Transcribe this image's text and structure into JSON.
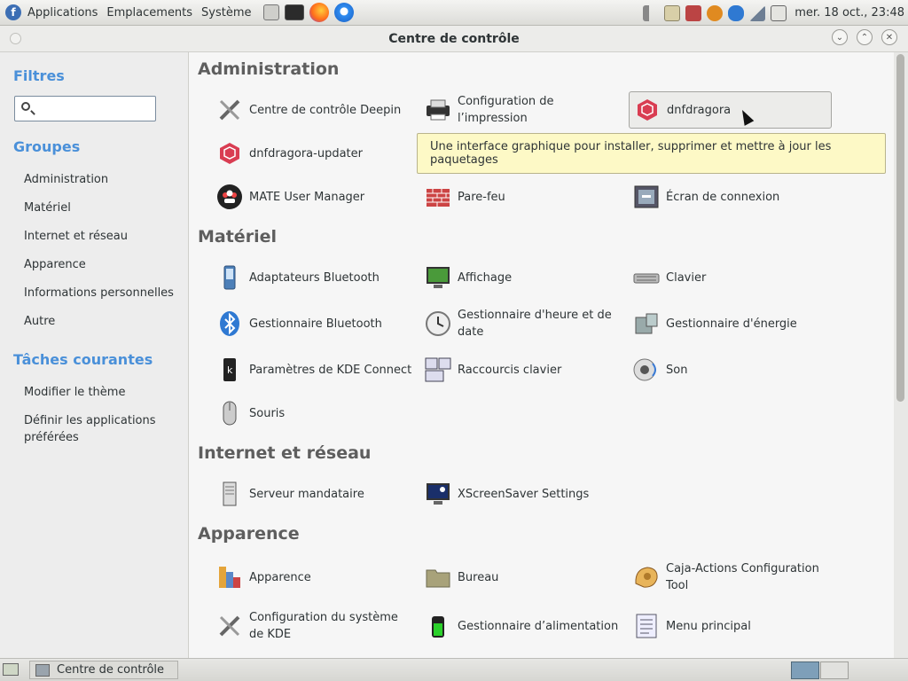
{
  "top_panel": {
    "menus": [
      "Applications",
      "Emplacements",
      "Système"
    ],
    "clock": "mer. 18 oct., 23:48"
  },
  "window": {
    "title": "Centre de contrôle"
  },
  "sidebar": {
    "filters_heading": "Filtres",
    "search_value": "",
    "groups_heading": "Groupes",
    "groups": [
      "Administration",
      "Matériel",
      "Internet et réseau",
      "Apparence",
      "Informations personnelles",
      "Autre"
    ],
    "tasks_heading": "Tâches courantes",
    "tasks": [
      "Modifier le thème",
      "Définir les applications préférées"
    ]
  },
  "sections": [
    {
      "title": "Administration",
      "items": [
        "Centre de contrôle Deepin",
        "Configuration de l’impression",
        "dnfdragora",
        "dnfdragora-updater",
        "MATE User Manager",
        "Pare-feu",
        "Écran de connexion"
      ]
    },
    {
      "title": "Matériel",
      "items": [
        "Adaptateurs Bluetooth",
        "Affichage",
        "Clavier",
        "Gestionnaire Bluetooth",
        "Gestionnaire d'heure et de date",
        "Gestionnaire d'énergie",
        "Paramètres de KDE Connect",
        "Raccourcis clavier",
        "Son",
        "Souris"
      ]
    },
    {
      "title": "Internet et réseau",
      "items": [
        "Serveur mandataire",
        "XScreenSaver Settings"
      ]
    },
    {
      "title": "Apparence",
      "items": [
        "Apparence",
        "Bureau",
        "Caja-Actions Configuration Tool",
        "Configuration du système de KDE",
        "Gestionnaire d’alimentation",
        "Menu principal"
      ]
    }
  ],
  "tooltip": "Une interface graphique pour installer, supprimer et mettre à jour les paquetages",
  "taskbar": {
    "window_button": "Centre de contrôle"
  },
  "colors": {
    "accent_heading": "#4a90d9",
    "tooltip_bg": "#fdf9c6",
    "section_heading": "#5e5e5e"
  }
}
